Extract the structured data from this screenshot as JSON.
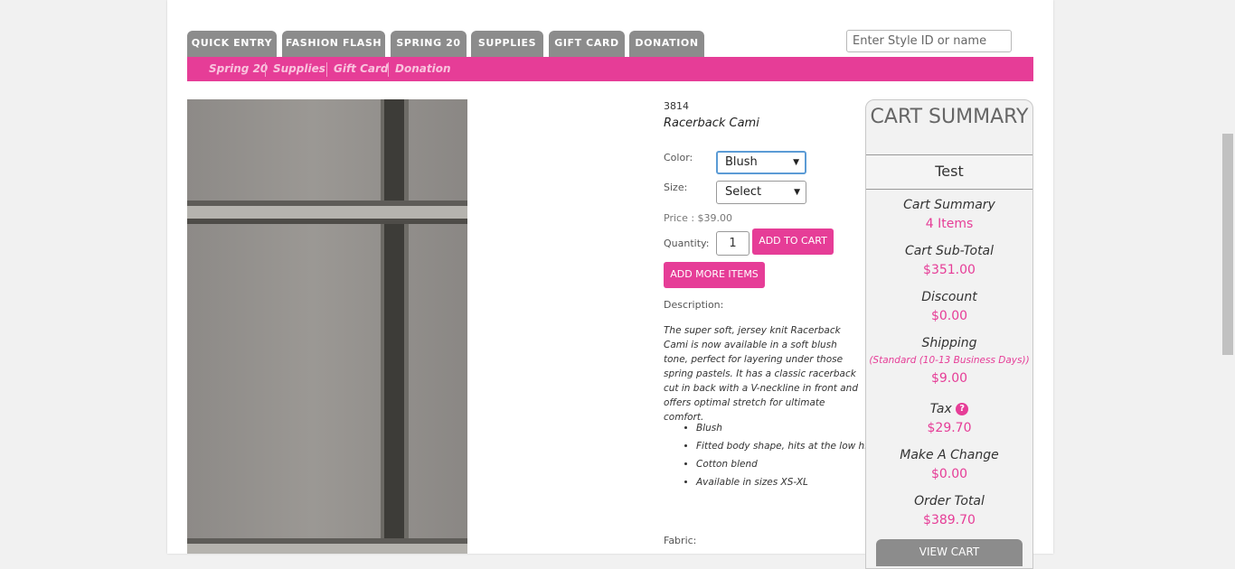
{
  "tabs": [
    {
      "label": "QUICK ENTRY"
    },
    {
      "label": "FASHION FLASH"
    },
    {
      "label": "SPRING 20"
    },
    {
      "label": "SUPPLIES"
    },
    {
      "label": "GIFT CARD"
    },
    {
      "label": "DONATION"
    }
  ],
  "search": {
    "placeholder": "Enter Style ID or name"
  },
  "subnav": [
    {
      "label": "Spring 20"
    },
    {
      "label": "Supplies"
    },
    {
      "label": "Gift Card"
    },
    {
      "label": "Donation"
    }
  ],
  "product": {
    "sku": "3814",
    "name": "Racerback Cami",
    "color_label": "Color:",
    "color_value": "Blush",
    "size_label": "Size:",
    "size_value": "Select",
    "price": "Price : $39.00",
    "quantity_label": "Quantity:",
    "quantity_value": "1",
    "add_to_cart": "ADD TO CART",
    "add_more": "ADD MORE ITEMS",
    "description_label": "Description:",
    "description": "The super soft, jersey knit Racerback Cami is now available in a soft blush tone, perfect for layering under those spring pastels. It has a classic racerback cut in back with a V-neckline in front and offers optimal stretch for ultimate comfort.",
    "bullets": [
      "Blush",
      "Fitted body shape, hits at the low hip",
      "Cotton blend",
      "Available in sizes XS-XL"
    ],
    "fabric_label": "Fabric:"
  },
  "cart": {
    "title": "CART SUMMARY",
    "name": "Test",
    "summary_label": "Cart Summary",
    "items": "4 Items",
    "subtotal_label": "Cart Sub-Total",
    "subtotal": "$351.00",
    "discount_label": "Discount",
    "discount": "$0.00",
    "shipping_label": "Shipping",
    "shipping_method": "(Standard (10-13 Business Days))",
    "shipping": "$9.00",
    "tax_label": "Tax",
    "tax_help": "?",
    "tax": "$29.70",
    "change_label": "Make A Change",
    "change": "$0.00",
    "total_label": "Order Total",
    "total": "$389.70",
    "view_cart": "VIEW CART"
  },
  "colors": {
    "accent": "#e63d97",
    "tab_gray": "#8c8c8c"
  }
}
